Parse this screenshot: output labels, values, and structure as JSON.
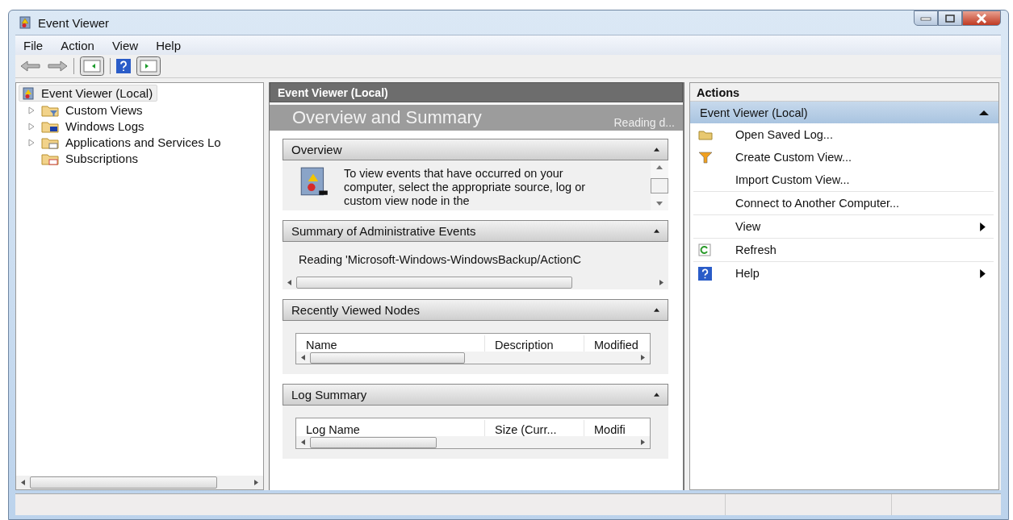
{
  "window": {
    "title": "Event Viewer"
  },
  "menu": [
    "File",
    "Action",
    "View",
    "Help"
  ],
  "tree": {
    "label": "Event Viewer (Local)",
    "selected": true,
    "children": [
      {
        "label": "Custom Views",
        "expandable": true,
        "selected": false
      },
      {
        "label": "Windows Logs",
        "expandable": true,
        "selected": false
      },
      {
        "label": "Applications and Services Lo",
        "expandable": true,
        "selected": false
      },
      {
        "label": "Subscriptions",
        "expandable": false,
        "selected": false
      }
    ]
  },
  "center": {
    "header": "Event Viewer (Local)",
    "title": "Overview and Summary",
    "status": "Reading d...",
    "sections": [
      {
        "kind": "text",
        "title": "Overview",
        "text": "To view events that have occurred on your computer, select the appropriate source, log or custom view node in the"
      },
      {
        "kind": "reading",
        "title": "Summary of Administrative Events",
        "text": "Reading 'Microsoft-Windows-WindowsBackup/ActionC"
      },
      {
        "kind": "table",
        "title": "Recently Viewed Nodes",
        "columns": [
          "Name",
          "Description",
          "Modified"
        ]
      },
      {
        "kind": "table",
        "title": "Log Summary",
        "columns": [
          "Log Name",
          "Size (Curr...",
          "Modifi"
        ]
      }
    ]
  },
  "actions": {
    "title": "Actions",
    "group": "Event Viewer (Local)",
    "items": [
      {
        "label": "Open Saved Log...",
        "submenu": false,
        "divider": false
      },
      {
        "label": "Create Custom View...",
        "submenu": false,
        "divider": false
      },
      {
        "label": "Import Custom View...",
        "submenu": false,
        "divider": true
      },
      {
        "label": "Connect to Another Computer...",
        "submenu": false,
        "divider": true
      },
      {
        "label": "View",
        "submenu": true,
        "divider": true
      },
      {
        "label": "Refresh",
        "submenu": false,
        "divider": true
      },
      {
        "label": "Help",
        "submenu": true,
        "divider": false
      }
    ]
  }
}
